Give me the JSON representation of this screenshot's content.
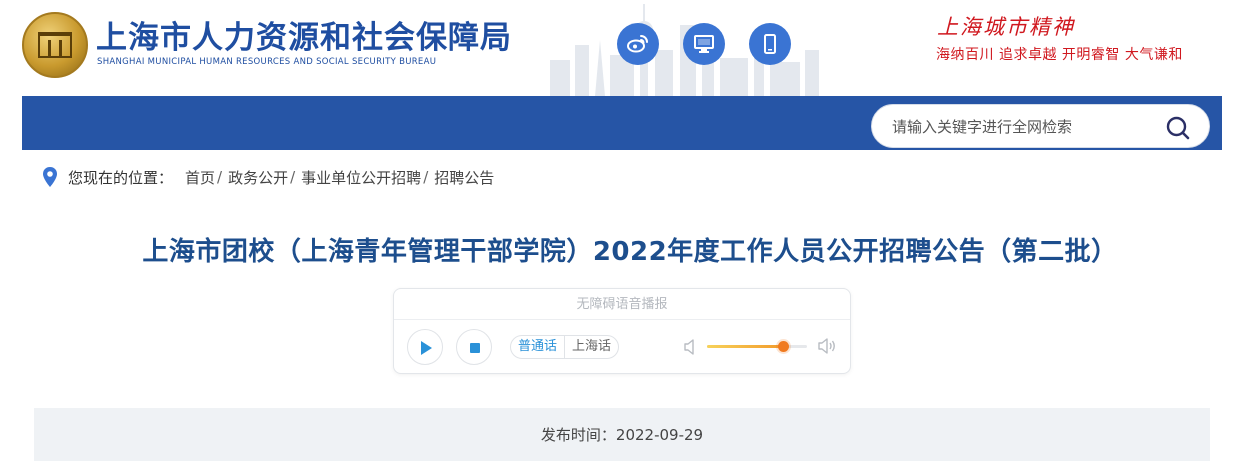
{
  "header": {
    "org_name_cn": "上海市人力资源和社会保障局",
    "org_name_en": "SHANGHAI MUNICIPAL HUMAN RESOURCES AND SOCIAL SECURITY BUREAU",
    "icons": [
      "weibo-icon",
      "desktop-icon",
      "mobile-icon"
    ],
    "spirit_title": "上海城市精神",
    "spirit_motto": "海纳百川  追求卓越  开明睿智  大气谦和"
  },
  "search": {
    "placeholder": "请输入关键字进行全网检索"
  },
  "breadcrumb": {
    "label": "您现在的位置：",
    "items": [
      "首页",
      "政务公开",
      "事业单位公开招聘",
      "招聘公告"
    ],
    "separator": "/"
  },
  "article": {
    "title": "上海市团校（上海青年管理干部学院）2022年度工作人员公开招聘公告（第二批）"
  },
  "player": {
    "label": "无障碍语音播报",
    "languages": [
      "普通话",
      "上海话"
    ],
    "active_language": "普通话",
    "volume": 0.76
  },
  "publish": {
    "text": "发布时间：2022-09-29"
  },
  "colors": {
    "brand_blue": "#2655a6",
    "title_blue": "#1d4e8d",
    "accent_red": "#d0181f",
    "volume_orange": "#f07a1f"
  }
}
